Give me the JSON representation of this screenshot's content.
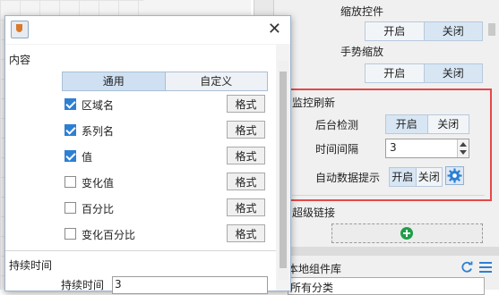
{
  "dialog": {
    "section_content": "内容",
    "tabs": [
      "通用",
      "自定义"
    ],
    "items": [
      {
        "label": "区域名",
        "checked": true,
        "button": "格式"
      },
      {
        "label": "系列名",
        "checked": true,
        "button": "格式"
      },
      {
        "label": "值",
        "checked": true,
        "button": "格式"
      },
      {
        "label": "变化值",
        "checked": false,
        "button": "格式"
      },
      {
        "label": "百分比",
        "checked": false,
        "button": "格式"
      },
      {
        "label": "变化百分比",
        "checked": false,
        "button": "格式"
      }
    ],
    "section_duration": "持续时间",
    "duration_label": "持续时间",
    "duration_value": "3"
  },
  "panel": {
    "zoom_control": {
      "label": "缩放控件",
      "on": "开启",
      "off": "关闭"
    },
    "gesture_zoom": {
      "label": "手势缩放",
      "on": "开启",
      "off": "关闭"
    },
    "monitor_refresh": {
      "title": "监控刷新",
      "bg_check": {
        "label": "后台检测",
        "on": "开启",
        "off": "关闭"
      },
      "interval": {
        "label": "时间间隔",
        "value": "3"
      },
      "auto_tip": {
        "label": "自动数据提示",
        "on": "开启",
        "off": "关闭"
      }
    },
    "hyperlink": {
      "title": "超级链接"
    },
    "local_lib": {
      "title": "本地组件库",
      "category": "所有分类"
    }
  },
  "colors": {
    "highlight": "#e64848",
    "accent": "#2d7fd3",
    "add": "#1e9e48"
  }
}
